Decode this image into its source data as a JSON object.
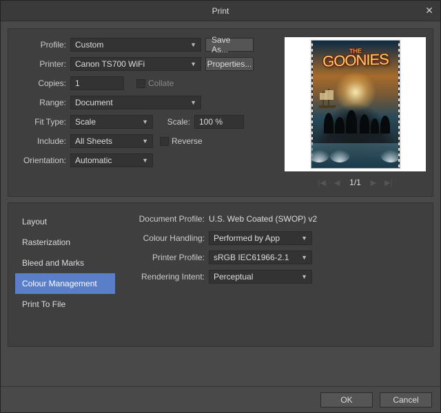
{
  "window": {
    "title": "Print"
  },
  "form": {
    "profile_label": "Profile:",
    "profile_value": "Custom",
    "saveas": "Save As...",
    "printer_label": "Printer:",
    "printer_value": "Canon TS700 WiFi",
    "properties": "Properties...",
    "copies_label": "Copies:",
    "copies_value": "1",
    "collate": "Collate",
    "range_label": "Range:",
    "range_value": "Document",
    "fit_label": "Fit Type:",
    "fit_value": "Scale",
    "scale_label": "Scale:",
    "scale_value": "100 %",
    "include_label": "Include:",
    "include_value": "All Sheets",
    "reverse": "Reverse",
    "orient_label": "Orientation:",
    "orient_value": "Automatic"
  },
  "preview": {
    "poster_the": "THE",
    "poster_title": "GOONIES",
    "page": "1/1"
  },
  "tabs": {
    "items": [
      "Layout",
      "Rasterization",
      "Bleed and Marks",
      "Colour Management",
      "Print To File"
    ],
    "active_index": 3
  },
  "colour": {
    "docprofile_label": "Document Profile:",
    "docprofile_value": "U.S. Web Coated (SWOP) v2",
    "handling_label": "Colour Handling:",
    "handling_value": "Performed by App",
    "pprofile_label": "Printer Profile:",
    "pprofile_value": "sRGB IEC61966-2.1",
    "intent_label": "Rendering Intent:",
    "intent_value": "Perceptual"
  },
  "footer": {
    "ok": "OK",
    "cancel": "Cancel"
  }
}
